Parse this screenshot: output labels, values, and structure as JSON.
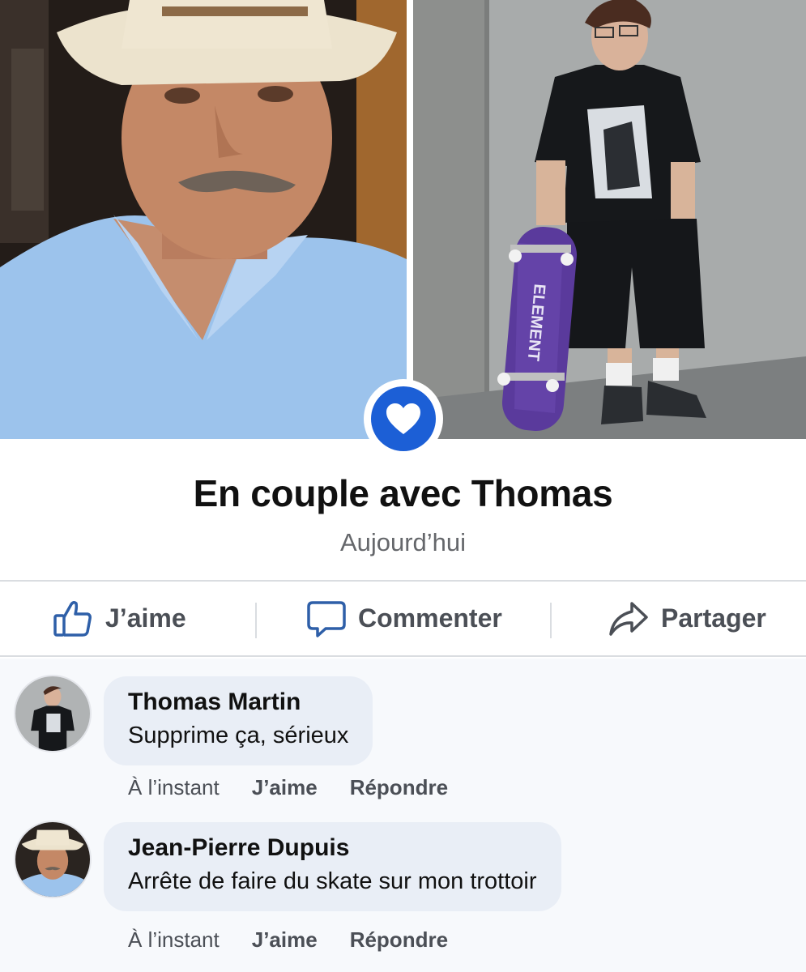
{
  "post": {
    "left_photo_alt": "man-in-hat-photo",
    "right_photo_alt": "young-man-with-skateboard-photo",
    "skateboard_brand": "ELEMENT",
    "badge_icon": "heart-icon",
    "title": "En couple avec Thomas",
    "subtitle": "Aujourd’hui"
  },
  "actions": [
    {
      "label": "J’aime",
      "icon": "thumbs-up-icon"
    },
    {
      "label": "Commenter",
      "icon": "comment-bubble-icon"
    },
    {
      "label": "Partager",
      "icon": "share-arrow-icon"
    }
  ],
  "comments": [
    {
      "author": "Thomas Martin",
      "text": "Supprime ça, sérieux",
      "time": "À l’instant",
      "like_label": "J’aime",
      "reply_label": "Répondre"
    },
    {
      "author": "Jean-Pierre Dupuis",
      "text": "Arrête de faire du skate sur mon trottoir",
      "time": "À l’instant",
      "like_label": "J’aime",
      "reply_label": "Répondre"
    }
  ],
  "colors": {
    "accent": "#1c5fd6",
    "secondary_text": "#65676b",
    "action_text": "#4b4f56",
    "bubble": "#e9eef6",
    "divider": "#dadde1"
  }
}
